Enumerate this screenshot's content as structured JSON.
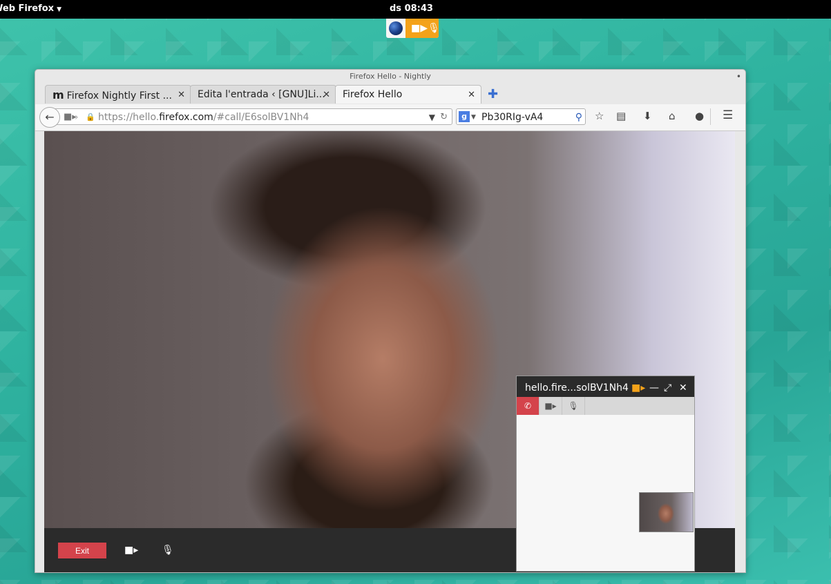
{
  "topbar": {
    "app_name": "Web Firefox",
    "clock": "ds 08:43"
  },
  "window": {
    "title": "Firefox Hello - Nightly"
  },
  "tabs": [
    {
      "label": "Firefox Nightly First ...",
      "active": false
    },
    {
      "label": "Edita l'entrada ‹ [GNU]Li...",
      "active": false
    },
    {
      "label": "Firefox Hello",
      "active": true
    }
  ],
  "navbar": {
    "url_prefix": "https://hello.",
    "url_domain": "firefox.com",
    "url_suffix": "/#call/E6solBV1Nh4",
    "search_text": "Pb30RIg-vA4"
  },
  "call": {
    "exit_label": "Exit"
  },
  "mini_window": {
    "title": "hello.fire...solBV1Nh4"
  },
  "colors": {
    "hangup_red": "#d4434b",
    "camera_orange": "#f4a21a",
    "desktop_teal": "#2fb3a0"
  }
}
